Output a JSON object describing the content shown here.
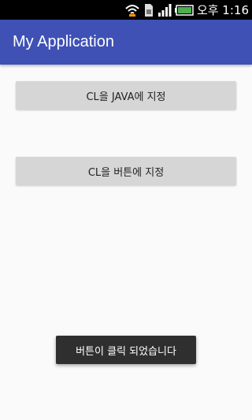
{
  "status_bar": {
    "time": "오후 1:16",
    "icons": [
      "wifi-hotspot-icon",
      "sim-card-icon",
      "signal-icon",
      "battery-icon"
    ]
  },
  "app_bar": {
    "title": "My Application",
    "color": "#3f51b5"
  },
  "buttons": [
    {
      "label": "CL을 JAVA에 지정"
    },
    {
      "label": "CL을 버튼에 지정"
    }
  ],
  "toast": {
    "message": "버튼이 클릭 되었습니다"
  }
}
